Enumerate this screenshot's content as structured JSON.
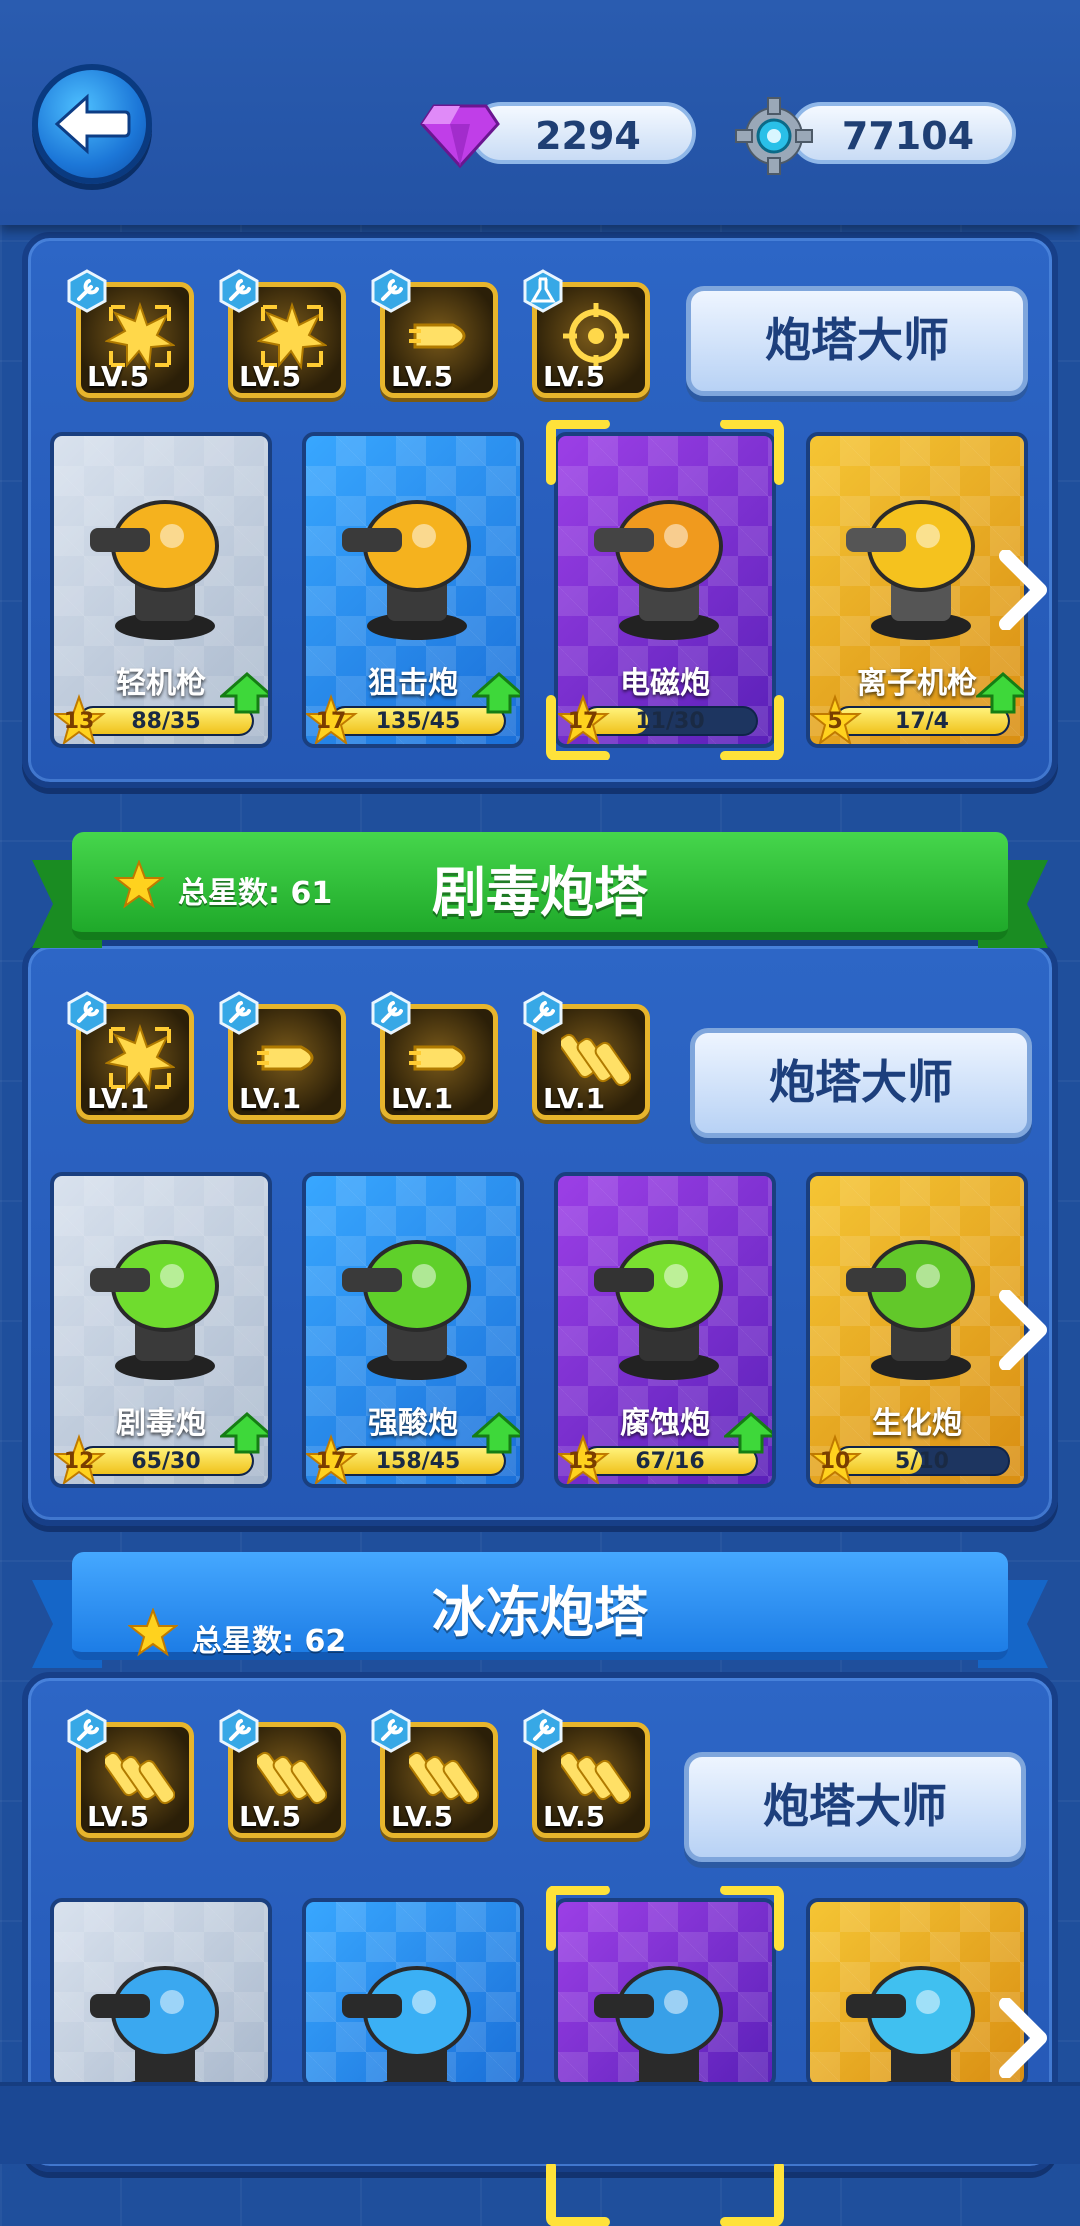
{
  "header": {
    "gems": "2294",
    "gears": "77104"
  },
  "sections": [
    {
      "title": "",
      "total_stars_label": "",
      "skills": [
        {
          "level": "LV.5",
          "icon": "explosion-icon",
          "badge": "wrench-icon"
        },
        {
          "level": "LV.5",
          "icon": "explosion-icon",
          "badge": "wrench-icon"
        },
        {
          "level": "LV.5",
          "icon": "bullet-icon",
          "badge": "wrench-icon"
        },
        {
          "level": "LV.5",
          "icon": "crosshair-icon",
          "badge": "flask-icon"
        }
      ],
      "master_label": "炮塔大师",
      "towers": [
        {
          "name": "轻机枪",
          "level": "13",
          "progress": "88/35",
          "fill": 1.0,
          "rarity": "white",
          "upgrade": true
        },
        {
          "name": "狙击炮",
          "level": "17",
          "progress": "135/45",
          "fill": 1.0,
          "rarity": "blue",
          "upgrade": true
        },
        {
          "name": "电磁炮",
          "level": "17",
          "progress": "11/30",
          "fill": 0.37,
          "rarity": "purple",
          "upgrade": false,
          "selected": true
        },
        {
          "name": "离子机枪",
          "level": "5",
          "progress": "17/4",
          "fill": 1.0,
          "rarity": "gold",
          "upgrade": true
        }
      ]
    },
    {
      "title": "剧毒炮塔",
      "total_stars_label": "总星数: 61",
      "skills": [
        {
          "level": "LV.1",
          "icon": "explosion-icon",
          "badge": "wrench-icon"
        },
        {
          "level": "LV.1",
          "icon": "bullet-icon",
          "badge": "wrench-icon"
        },
        {
          "level": "LV.1",
          "icon": "bullet-icon",
          "badge": "wrench-icon"
        },
        {
          "level": "LV.1",
          "icon": "ammo-icon",
          "badge": "wrench-icon"
        }
      ],
      "master_label": "炮塔大师",
      "towers": [
        {
          "name": "剧毒炮",
          "level": "12",
          "progress": "65/30",
          "fill": 1.0,
          "rarity": "white",
          "upgrade": true
        },
        {
          "name": "强酸炮",
          "level": "17",
          "progress": "158/45",
          "fill": 1.0,
          "rarity": "blue",
          "upgrade": true
        },
        {
          "name": "腐蚀炮",
          "level": "13",
          "progress": "67/16",
          "fill": 1.0,
          "rarity": "purple",
          "upgrade": true
        },
        {
          "name": "生化炮",
          "level": "10",
          "progress": "5/10",
          "fill": 0.5,
          "rarity": "gold",
          "upgrade": false
        }
      ]
    },
    {
      "title": "冰冻炮塔",
      "total_stars_label": "总星数: 62",
      "skills": [
        {
          "level": "LV.5",
          "icon": "ammo-icon",
          "badge": "wrench-icon"
        },
        {
          "level": "LV.5",
          "icon": "ammo-icon",
          "badge": "wrench-icon"
        },
        {
          "level": "LV.5",
          "icon": "ammo-icon",
          "badge": "wrench-icon"
        },
        {
          "level": "LV.5",
          "icon": "ammo-icon",
          "badge": "wrench-icon"
        }
      ],
      "master_label": "炮塔大师",
      "towers": [
        {
          "rarity": "white"
        },
        {
          "rarity": "blue"
        },
        {
          "rarity": "purple",
          "selected": true
        },
        {
          "rarity": "gold"
        }
      ]
    }
  ]
}
